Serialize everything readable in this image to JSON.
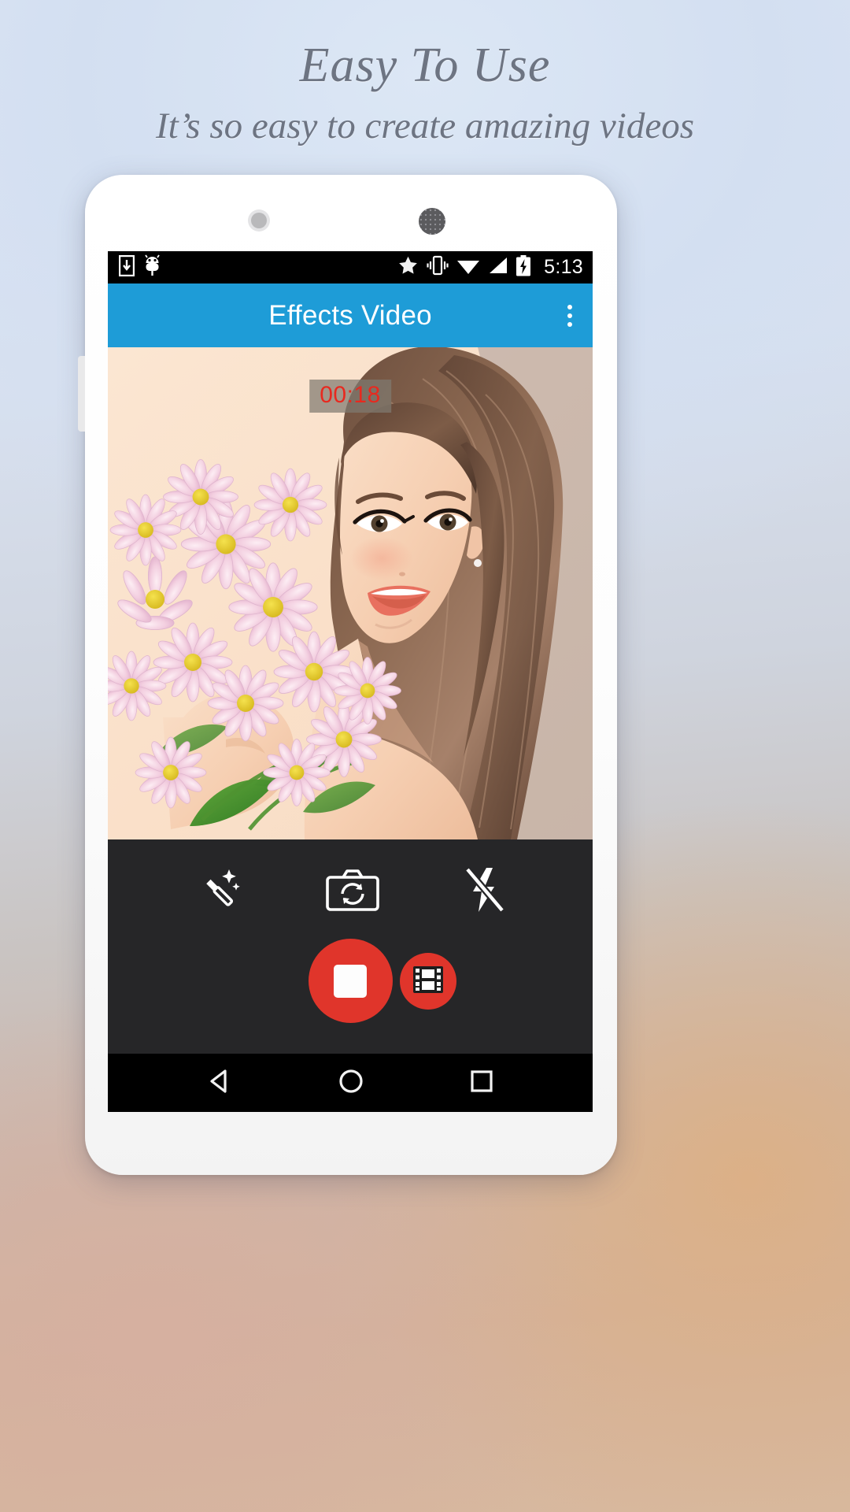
{
  "promo": {
    "headline": "Easy To Use",
    "subheadline": "It’s so easy to create amazing videos",
    "headline_color": "#6d7482"
  },
  "phone": {
    "status_bar": {
      "time": "5:13",
      "background": "#000000",
      "icons_left": [
        "download-icon",
        "android-icon"
      ],
      "icons_right": [
        "star-icon",
        "vibrate-icon",
        "wifi-icon",
        "signal-icon",
        "battery-charging-icon"
      ]
    },
    "toolbar": {
      "title": "Effects Video",
      "background": "#1e9cd7",
      "overflow_menu_icon": "more-vertical-icon"
    },
    "preview": {
      "recording_timer": "00:18",
      "timer_color": "#e8291f",
      "timer_background": "rgba(128,122,112,0.72)"
    },
    "controls": {
      "background": "#262628",
      "buttons": [
        {
          "name": "effects-button",
          "icon": "magic-wand-icon",
          "label": "Effects"
        },
        {
          "name": "switch-camera-button",
          "icon": "camera-flip-icon",
          "label": "Switch Camera"
        },
        {
          "name": "flash-button",
          "icon": "flash-off-icon",
          "label": "Flash Off"
        }
      ],
      "record_button": {
        "name": "stop-record-button",
        "icon": "stop-square-icon",
        "color": "#e0352b"
      },
      "gallery_button": {
        "name": "gallery-button",
        "icon": "film-strip-icon",
        "color": "#e0352b"
      }
    },
    "nav_bar": {
      "background": "#000000",
      "buttons": [
        {
          "name": "back-button",
          "icon": "triangle-back-icon"
        },
        {
          "name": "home-button",
          "icon": "circle-home-icon"
        },
        {
          "name": "recents-button",
          "icon": "square-recents-icon"
        }
      ]
    }
  }
}
